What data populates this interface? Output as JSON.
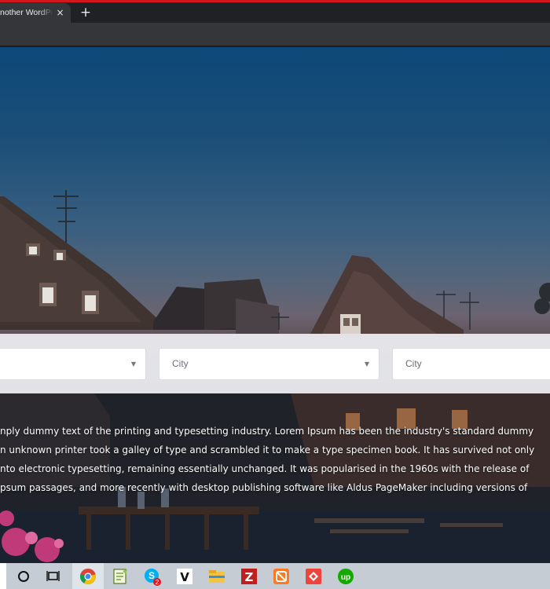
{
  "browser": {
    "tab_title": "nother WordPr",
    "tab_close_glyph": "×",
    "new_tab_glyph": "+",
    "accent_color": "#d4161e"
  },
  "search": {
    "select_1": {
      "value": "",
      "caret": "▼"
    },
    "select_2": {
      "value": "City",
      "caret": "▼"
    },
    "select_3": {
      "value": "City"
    }
  },
  "content": {
    "lines": [
      "nply dummy text of the printing and typesetting industry. Lorem Ipsum has been the industry's standard dummy",
      "n unknown printer took a galley of type and scrambled it to make a type specimen book. It has survived not only",
      "nto electronic typesetting, remaining essentially unchanged. It was popularised in the 1960s with the release of",
      "psum passages, and more recently with desktop publishing software like Aldus PageMaker including versions of"
    ]
  },
  "taskbar": {
    "icons": [
      "cortana-circle-icon",
      "task-view-icon",
      "chrome-icon",
      "notepad-plus-plus-icon",
      "skype-icon",
      "vectr-icon",
      "file-explorer-icon",
      "filezilla-icon",
      "xampp-icon",
      "anydesk-icon",
      "upwork-icon"
    ],
    "skype_badge": "2",
    "vectr_letter": "V",
    "filezilla_letter": "Z",
    "upwork_letters": "up"
  }
}
